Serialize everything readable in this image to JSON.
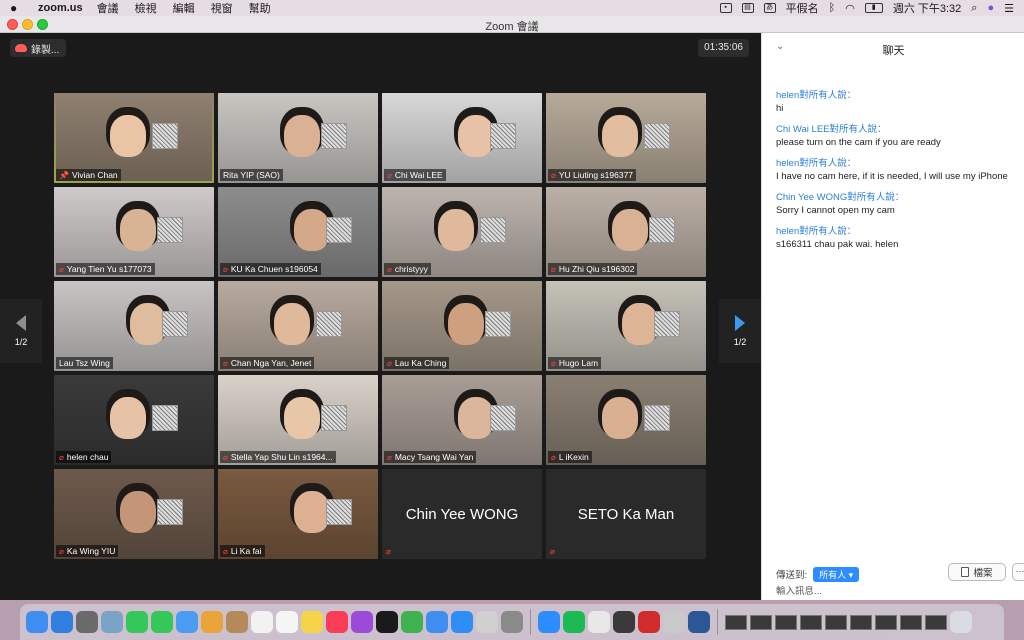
{
  "menubar": {
    "app_name": "zoom.us",
    "menus": [
      "會議",
      "檢視",
      "編輯",
      "視窗",
      "幫助"
    ],
    "input_method": "平假名",
    "battery_label": "",
    "clock": "週六 下午3:32"
  },
  "window": {
    "title": "Zoom 會議"
  },
  "video": {
    "record_label": "錄製...",
    "timer": "01:35:06",
    "page_left": "1/2",
    "page_right": "1/2",
    "participants": [
      {
        "name": "Vivian Chan",
        "video": true,
        "pinned": true,
        "muted": false,
        "active": true,
        "bg": "#8f8070",
        "face": "#e9c4a5"
      },
      {
        "name": "Rita YIP (SAO)",
        "video": true,
        "pinned": false,
        "muted": false,
        "active": false,
        "bg": "#c9c6c2",
        "face": "#d9b194"
      },
      {
        "name": "Chi Wai LEE",
        "video": true,
        "pinned": false,
        "muted": true,
        "active": false,
        "bg": "#d8d8d8",
        "face": "#e7c2a6"
      },
      {
        "name": "YU Liuting s196377",
        "video": true,
        "pinned": false,
        "muted": true,
        "active": false,
        "bg": "#b7aa99",
        "face": "#e3bd9f"
      },
      {
        "name": "Yang Tien Yu s177073",
        "video": true,
        "pinned": false,
        "muted": true,
        "active": false,
        "bg": "#cfcaca",
        "face": "#d8b394"
      },
      {
        "name": "KU Ka Chuen s196054",
        "video": true,
        "pinned": false,
        "muted": true,
        "active": false,
        "bg": "#8d8d8d",
        "face": "#d3a98a"
      },
      {
        "name": "christyyy",
        "video": true,
        "pinned": false,
        "muted": true,
        "active": false,
        "bg": "#bdb4ad",
        "face": "#e0b89b"
      },
      {
        "name": "Hu Zhi Qiu s196302",
        "video": true,
        "pinned": false,
        "muted": true,
        "active": false,
        "bg": "#bcb0a6",
        "face": "#d9b195"
      },
      {
        "name": "Lau Tsz Wing",
        "video": true,
        "pinned": false,
        "muted": false,
        "active": false,
        "bg": "#c8c4c4",
        "face": "#e0bc9f"
      },
      {
        "name": "Chan Nga Yan, Jenet",
        "video": true,
        "pinned": false,
        "muted": true,
        "active": false,
        "bg": "#b8aa9e",
        "face": "#e0b89a"
      },
      {
        "name": "Lau Ka Ching",
        "video": true,
        "pinned": false,
        "muted": true,
        "active": false,
        "bg": "#a49889",
        "face": "#cfa080"
      },
      {
        "name": "Hugo Lam",
        "video": true,
        "pinned": false,
        "muted": true,
        "active": false,
        "bg": "#c5c2b8",
        "face": "#ddb596"
      },
      {
        "name": "helen chau",
        "video": true,
        "pinned": false,
        "muted": true,
        "active": false,
        "bg": "#3a3a3a",
        "face": "#e6c3a6"
      },
      {
        "name": "Stella Yap Shu Lin s1964...",
        "video": true,
        "pinned": false,
        "muted": true,
        "active": false,
        "bg": "#d9d2ca",
        "face": "#e8c6a8"
      },
      {
        "name": "Macy Tsang Wai Yan",
        "video": true,
        "pinned": false,
        "muted": true,
        "active": false,
        "bg": "#a99e96",
        "face": "#dbb69a"
      },
      {
        "name": "L iKexin",
        "video": true,
        "pinned": false,
        "muted": true,
        "active": false,
        "bg": "#8a7f72",
        "face": "#d9b091"
      },
      {
        "name": "Ka Wing YIU",
        "video": true,
        "pinned": false,
        "muted": true,
        "active": false,
        "bg": "#6e5a4c",
        "face": "#c49677"
      },
      {
        "name": "Li Ka fai",
        "video": true,
        "pinned": false,
        "muted": true,
        "active": false,
        "bg": "#7a5a40",
        "face": "#dcb090"
      },
      {
        "name": "Chin Yee WONG",
        "video": false,
        "pinned": false,
        "muted": true,
        "active": false,
        "bg": "#2a2a2a",
        "face": ""
      },
      {
        "name": "SETO Ka Man",
        "video": false,
        "pinned": false,
        "muted": true,
        "active": false,
        "bg": "#2a2a2a",
        "face": ""
      }
    ]
  },
  "chat": {
    "title": "聊天",
    "messages": [
      {
        "sender": "helen",
        "to": "對所有人說：",
        "text": "hi"
      },
      {
        "sender": "Chi Wai LEE",
        "to": "對所有人說：",
        "text": "please turn on the cam if you are ready"
      },
      {
        "sender": "helen",
        "to": "對所有人說：",
        "text": "I have no cam here, if it is needed, I will use my iPhone"
      },
      {
        "sender": "Chin Yee WONG",
        "to": "對所有人說：",
        "text": "Sorry I cannot open my cam"
      },
      {
        "sender": "helen",
        "to": "對所有人說：",
        "text": "s166311 chau pak wai. helen"
      }
    ],
    "send_to_label": "傳送到:",
    "recipient": "所有人 ▾",
    "file_label": "檔案",
    "more_label": "···",
    "input_placeholder": "輸入訊息..."
  },
  "dock": {
    "apps": [
      {
        "name": "finder-icon",
        "color": "#3d8ef0",
        "glyph": ""
      },
      {
        "name": "safari-icon",
        "color": "#2f7fe0",
        "glyph": ""
      },
      {
        "name": "launchpad-icon",
        "color": "#6a6a6a",
        "glyph": ""
      },
      {
        "name": "preview-icon",
        "color": "#7aa3c8",
        "glyph": ""
      },
      {
        "name": "facetime-icon",
        "color": "#35c759",
        "glyph": ""
      },
      {
        "name": "messages-icon",
        "color": "#35c759",
        "glyph": ""
      },
      {
        "name": "mail-icon",
        "color": "#4a9cf2",
        "glyph": ""
      },
      {
        "name": "photos-icon",
        "color": "#e9a43a",
        "glyph": ""
      },
      {
        "name": "contacts-icon",
        "color": "#b58a5a",
        "glyph": ""
      },
      {
        "name": "calendar-icon",
        "color": "#f2f2f2",
        "glyph": ""
      },
      {
        "name": "reminders-icon",
        "color": "#f5f5f5",
        "glyph": ""
      },
      {
        "name": "notes-icon",
        "color": "#f6d44a",
        "glyph": ""
      },
      {
        "name": "music-icon",
        "color": "#fa3c56",
        "glyph": ""
      },
      {
        "name": "podcasts-icon",
        "color": "#9b4bd8",
        "glyph": ""
      },
      {
        "name": "tv-icon",
        "color": "#1a1a1a",
        "glyph": ""
      },
      {
        "name": "numbers-icon",
        "color": "#3fb24f",
        "glyph": ""
      },
      {
        "name": "keynote-icon",
        "color": "#3d8ef0",
        "glyph": ""
      },
      {
        "name": "app-store-icon",
        "color": "#2f8ef5",
        "glyph": ""
      },
      {
        "name": "help-icon",
        "color": "#d0d0d0",
        "glyph": ""
      },
      {
        "name": "system-preferences-icon",
        "color": "#8a8a8a",
        "glyph": ""
      },
      {
        "name": "zoom-icon",
        "color": "#2d8cff",
        "glyph": ""
      },
      {
        "name": "spotify-icon",
        "color": "#1db954",
        "glyph": ""
      },
      {
        "name": "chrome-icon",
        "color": "#e8e8e8",
        "glyph": ""
      },
      {
        "name": "quicktime-icon",
        "color": "#3a3a3a",
        "glyph": ""
      },
      {
        "name": "acrobat-icon",
        "color": "#d12c2c",
        "glyph": ""
      },
      {
        "name": "image-capture-icon",
        "color": "#c9c9c9",
        "glyph": ""
      },
      {
        "name": "word-icon",
        "color": "#2b5797",
        "glyph": ""
      }
    ],
    "thumbs": 9,
    "trash": {
      "name": "trash-icon",
      "color": "#d9dde3"
    }
  }
}
